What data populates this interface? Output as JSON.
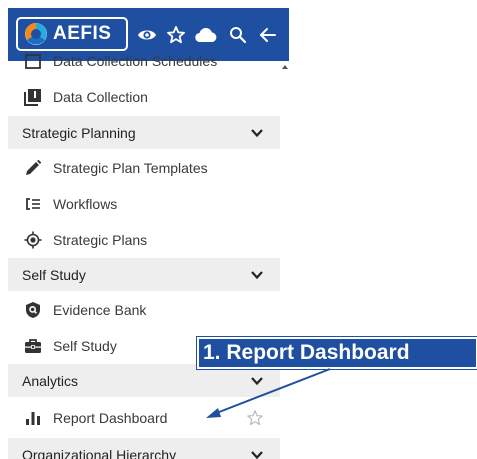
{
  "header": {
    "logo_text": "AEFIS",
    "icons": [
      "eye-icon",
      "star-outline-icon",
      "cloud-icon",
      "search-icon",
      "arrow-left-icon"
    ]
  },
  "sidebar": {
    "partial_top_item": "Data Collection Schedules",
    "items": [
      {
        "type": "item",
        "label": "Data Collection",
        "icon": "book-icon"
      },
      {
        "type": "section",
        "label": "Strategic Planning"
      },
      {
        "type": "item",
        "label": "Strategic Plan Templates",
        "icon": "pencil-icon"
      },
      {
        "type": "item",
        "label": "Workflows",
        "icon": "workflow-icon"
      },
      {
        "type": "item",
        "label": "Strategic Plans",
        "icon": "target-icon"
      },
      {
        "type": "section",
        "label": "Self Study"
      },
      {
        "type": "item",
        "label": "Evidence Bank",
        "icon": "shield-search-icon"
      },
      {
        "type": "item",
        "label": "Self Study",
        "icon": "briefcase-icon"
      },
      {
        "type": "section",
        "label": "Analytics"
      },
      {
        "type": "item",
        "label": "Report Dashboard",
        "icon": "bar-chart-icon"
      },
      {
        "type": "section",
        "label": "Organizational Hierarchy"
      }
    ]
  },
  "callout": {
    "label": "1. Report Dashboard"
  },
  "colors": {
    "brand_blue": "#1f4fa0",
    "section_bg": "#eeeeee",
    "logo_orange": "#f28a1e",
    "logo_blue": "#2aa8e0"
  }
}
